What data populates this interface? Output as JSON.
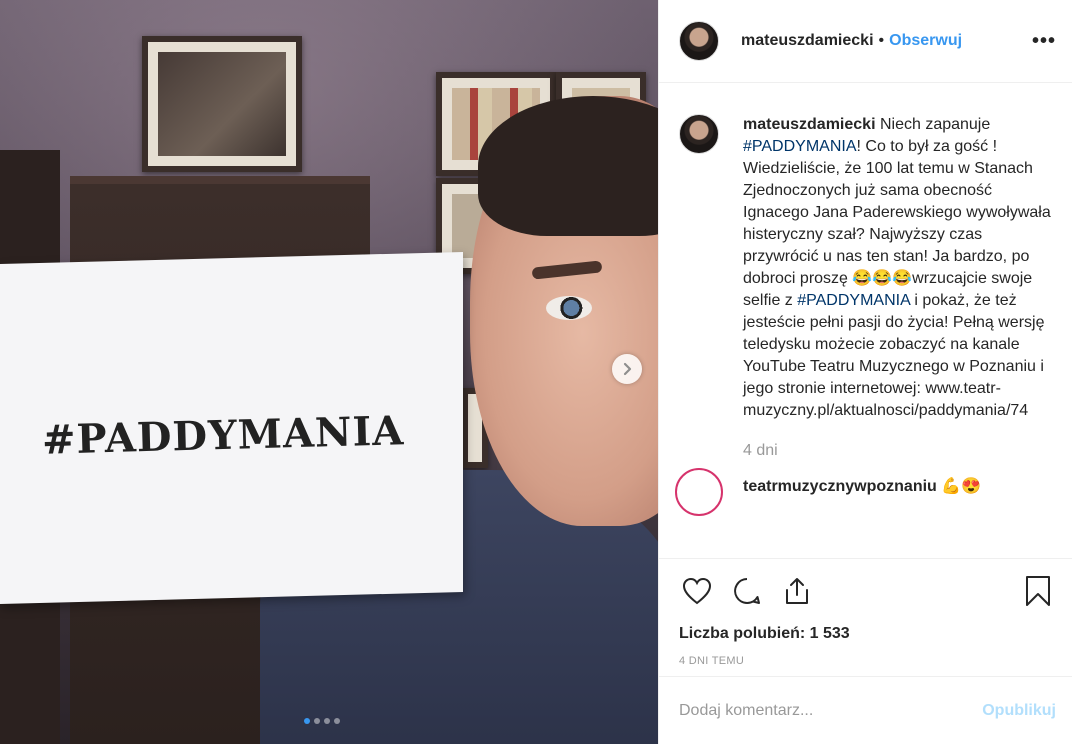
{
  "photo": {
    "sign_text": "#PADDYMANIA",
    "carousel": {
      "count": 4,
      "active": 0
    }
  },
  "header": {
    "username": "mateuszdamiecki",
    "separator": "•",
    "follow_label": "Obserwuj",
    "more_label": "•••"
  },
  "caption": {
    "username": "mateuszdamiecki",
    "text_1": " Niech zapanuje ",
    "tag_1": "#PADDYMANIA",
    "text_2": "! Co to był za gość ! Wiedzieliście, że 100 lat temu w Stanach Zjednoczonych już sama obecność Ignacego Jana Paderewskiego wywoływała histeryczny szał? Najwyższy czas przywrócić u nas ten stan! Ja bardzo, po dobroci proszę 😂😂😂wrzucajcie swoje selfie z ",
    "tag_2": "#PADDYMANIA",
    "text_3": " i pokaż, że też jesteście pełni pasji do życia! Pełną wersję teledysku możecie zobaczyć na kanale YouTube Teatru Muzycznego w Poznaniu i jego stronie internetowej: www.teatr-muzyczny.pl/aktualnosci/paddymania/74",
    "time": "4 dni"
  },
  "reply": {
    "username": "teatrmuzycznywpoznaniu 💪😍"
  },
  "actions": {
    "likes": "Liczba polubień: 1 533",
    "posted": "4 dni temu"
  },
  "comment_box": {
    "placeholder": "Dodaj komentarz...",
    "submit_label": "Opublikuj"
  },
  "colors": {
    "link": "#3897f0",
    "hashtag": "#003569",
    "muted": "#999999",
    "submit_disabled": "#b2dffc"
  }
}
